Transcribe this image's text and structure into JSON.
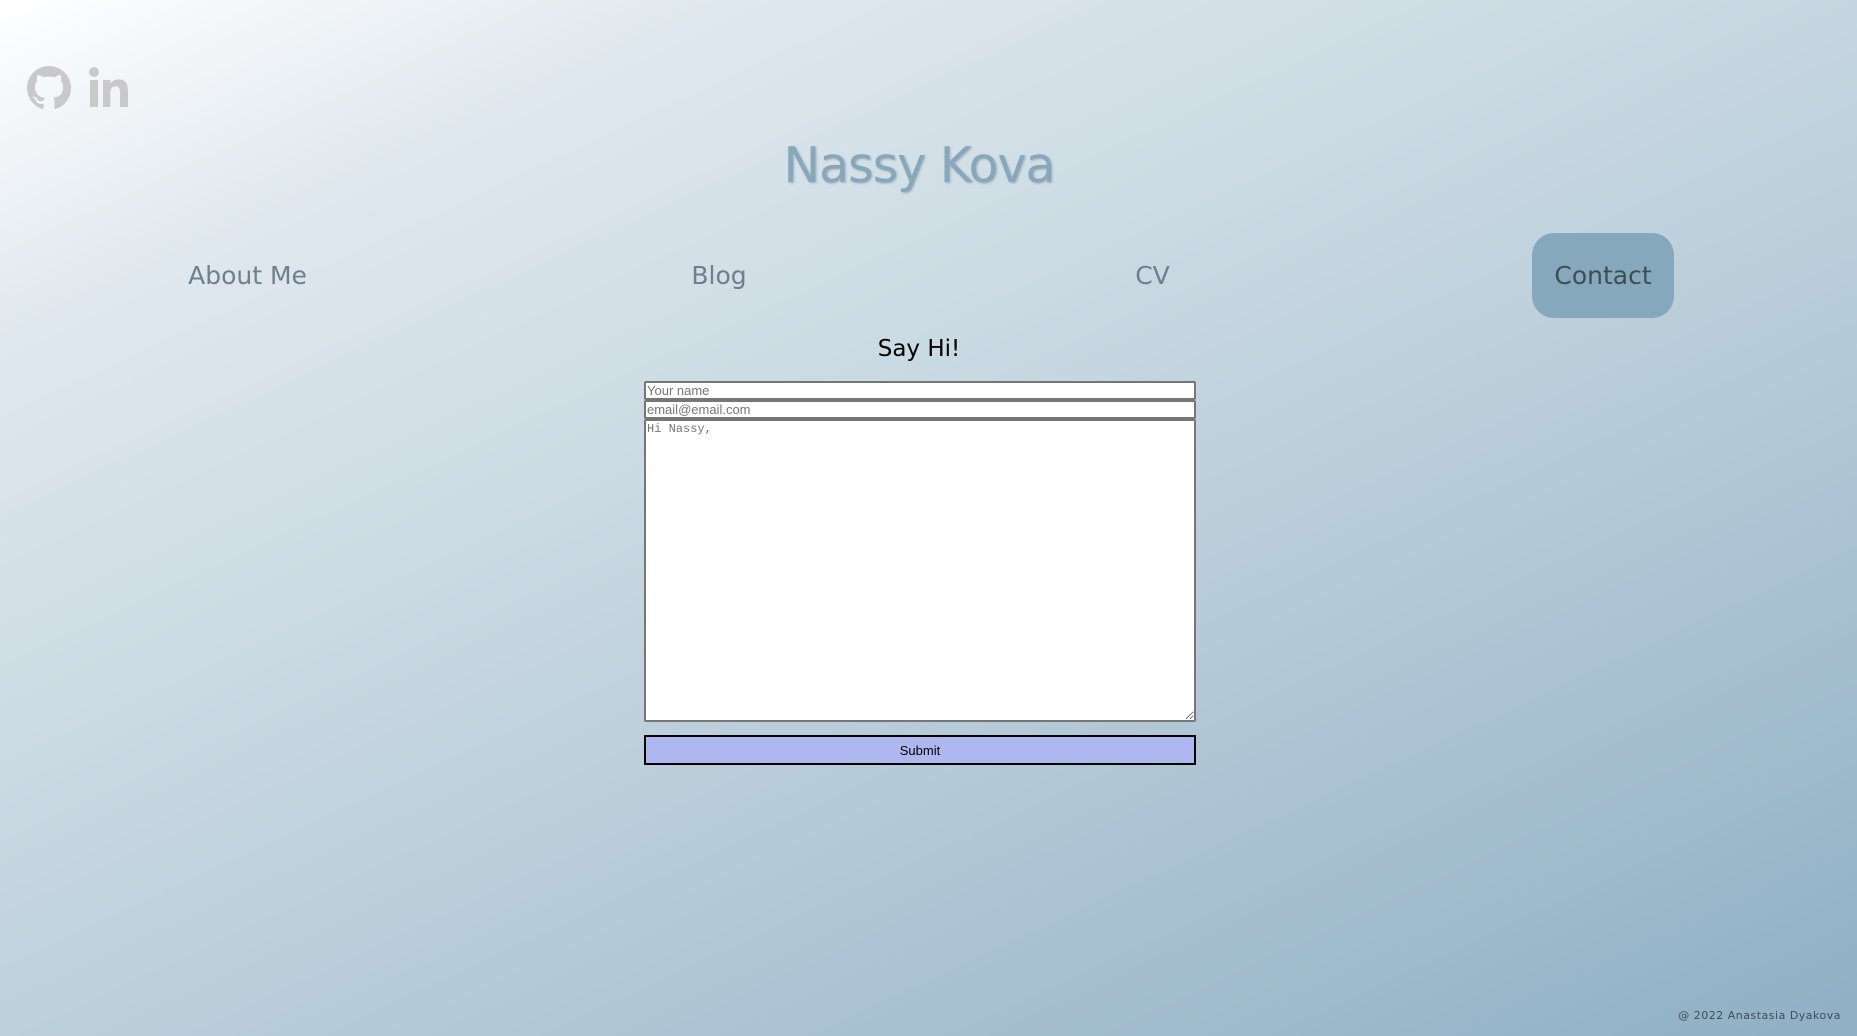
{
  "social": {
    "github_icon": "github-icon",
    "linkedin_icon": "linkedin-icon",
    "icon_color": "#c9c9c9"
  },
  "header": {
    "title": "Nassy Kova"
  },
  "nav": {
    "items": [
      {
        "label": "About Me",
        "active": false
      },
      {
        "label": "Blog",
        "active": false
      },
      {
        "label": "CV",
        "active": false
      },
      {
        "label": "Contact",
        "active": true
      }
    ],
    "active_color": "#86a8bd"
  },
  "contact_form": {
    "title": "Say Hi!",
    "name_placeholder": "Your name",
    "email_placeholder": "email@email.com",
    "message_placeholder": "Hi Nassy,",
    "submit_label": "Submit",
    "submit_color": "#aeb8ef"
  },
  "footer": {
    "text": "@ 2022 Anastasia Dyakova"
  }
}
